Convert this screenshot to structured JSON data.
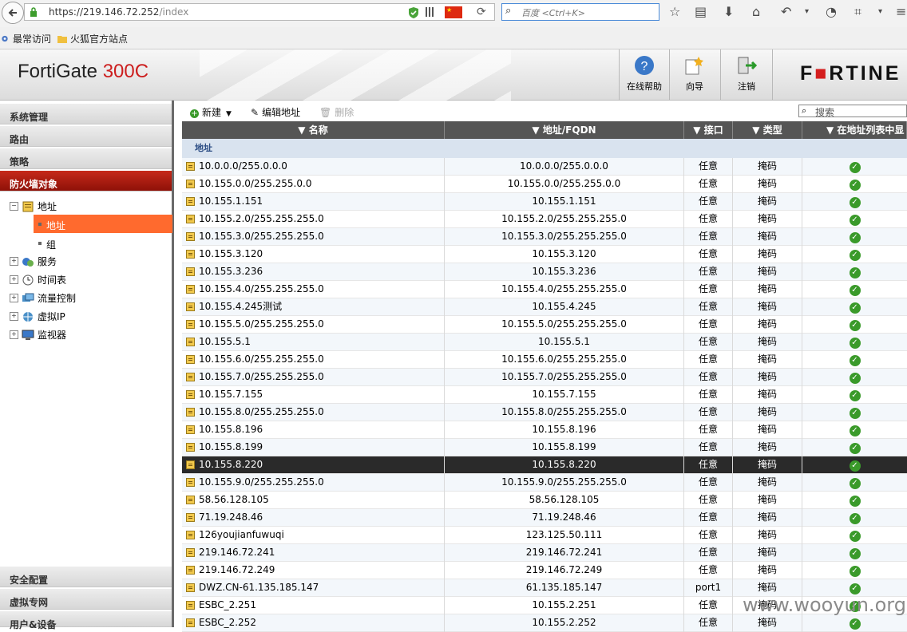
{
  "browser": {
    "url_host": "https://219.146.72.252",
    "url_path": "/index",
    "search_placeholder": "百度 <Ctrl+K>",
    "bookmarks": [
      "最常访问",
      "火狐官方站点"
    ]
  },
  "header": {
    "product": "FortiGate",
    "model": "300C",
    "buttons": [
      "在线帮助",
      "向导",
      "注销"
    ],
    "brand_part1": "F",
    "brand_part2": "RTINE"
  },
  "sidebar": {
    "top_categories": [
      "系统管理",
      "路由",
      "策略",
      "防火墙对象"
    ],
    "tree": [
      "地址",
      "服务",
      "时间表",
      "流量控制",
      "虚拟IP",
      "监视器"
    ],
    "leaves": [
      "地址",
      "组"
    ],
    "bottom_categories": [
      "安全配置",
      "虚拟专网",
      "用户&设备"
    ]
  },
  "toolbar": {
    "new_label": "新建",
    "edit_label": "编辑地址",
    "delete_label": "删除",
    "search_placeholder": "搜索"
  },
  "table": {
    "columns": [
      "名称",
      "地址/FQDN",
      "接口",
      "类型",
      "在地址列表中显"
    ],
    "group": "地址",
    "rows": [
      {
        "name": "10.0.0.0/255.0.0.0",
        "addr": "10.0.0.0/255.0.0.0",
        "if": "任意",
        "type": "掩码"
      },
      {
        "name": "10.155.0.0/255.255.0.0",
        "addr": "10.155.0.0/255.255.0.0",
        "if": "任意",
        "type": "掩码"
      },
      {
        "name": "10.155.1.151",
        "addr": "10.155.1.151",
        "if": "任意",
        "type": "掩码"
      },
      {
        "name": "10.155.2.0/255.255.255.0",
        "addr": "10.155.2.0/255.255.255.0",
        "if": "任意",
        "type": "掩码"
      },
      {
        "name": "10.155.3.0/255.255.255.0",
        "addr": "10.155.3.0/255.255.255.0",
        "if": "任意",
        "type": "掩码"
      },
      {
        "name": "10.155.3.120",
        "addr": "10.155.3.120",
        "if": "任意",
        "type": "掩码"
      },
      {
        "name": "10.155.3.236",
        "addr": "10.155.3.236",
        "if": "任意",
        "type": "掩码"
      },
      {
        "name": "10.155.4.0/255.255.255.0",
        "addr": "10.155.4.0/255.255.255.0",
        "if": "任意",
        "type": "掩码"
      },
      {
        "name": "10.155.4.245测试",
        "addr": "10.155.4.245",
        "if": "任意",
        "type": "掩码"
      },
      {
        "name": "10.155.5.0/255.255.255.0",
        "addr": "10.155.5.0/255.255.255.0",
        "if": "任意",
        "type": "掩码"
      },
      {
        "name": "10.155.5.1",
        "addr": "10.155.5.1",
        "if": "任意",
        "type": "掩码"
      },
      {
        "name": "10.155.6.0/255.255.255.0",
        "addr": "10.155.6.0/255.255.255.0",
        "if": "任意",
        "type": "掩码"
      },
      {
        "name": "10.155.7.0/255.255.255.0",
        "addr": "10.155.7.0/255.255.255.0",
        "if": "任意",
        "type": "掩码"
      },
      {
        "name": "10.155.7.155",
        "addr": "10.155.7.155",
        "if": "任意",
        "type": "掩码"
      },
      {
        "name": "10.155.8.0/255.255.255.0",
        "addr": "10.155.8.0/255.255.255.0",
        "if": "任意",
        "type": "掩码"
      },
      {
        "name": "10.155.8.196",
        "addr": "10.155.8.196",
        "if": "任意",
        "type": "掩码"
      },
      {
        "name": "10.155.8.199",
        "addr": "10.155.8.199",
        "if": "任意",
        "type": "掩码"
      },
      {
        "name": "10.155.8.220",
        "addr": "10.155.8.220",
        "if": "任意",
        "type": "掩码"
      },
      {
        "name": "10.155.9.0/255.255.255.0",
        "addr": "10.155.9.0/255.255.255.0",
        "if": "任意",
        "type": "掩码"
      },
      {
        "name": "58.56.128.105",
        "addr": "58.56.128.105",
        "if": "任意",
        "type": "掩码"
      },
      {
        "name": "71.19.248.46",
        "addr": "71.19.248.46",
        "if": "任意",
        "type": "掩码"
      },
      {
        "name": "126youjianfuwuqi",
        "addr": "123.125.50.111",
        "if": "任意",
        "type": "掩码"
      },
      {
        "name": "219.146.72.241",
        "addr": "219.146.72.241",
        "if": "任意",
        "type": "掩码"
      },
      {
        "name": "219.146.72.249",
        "addr": "219.146.72.249",
        "if": "任意",
        "type": "掩码"
      },
      {
        "name": "DWZ.CN-61.135.185.147",
        "addr": "61.135.185.147",
        "if": "port1",
        "type": "掩码"
      },
      {
        "name": "ESBC_2.251",
        "addr": "10.155.2.251",
        "if": "任意",
        "type": "掩码"
      },
      {
        "name": "ESBC_2.252",
        "addr": "10.155.2.252",
        "if": "任意",
        "type": "掩码"
      }
    ]
  },
  "watermark": "www.wooyun.org"
}
